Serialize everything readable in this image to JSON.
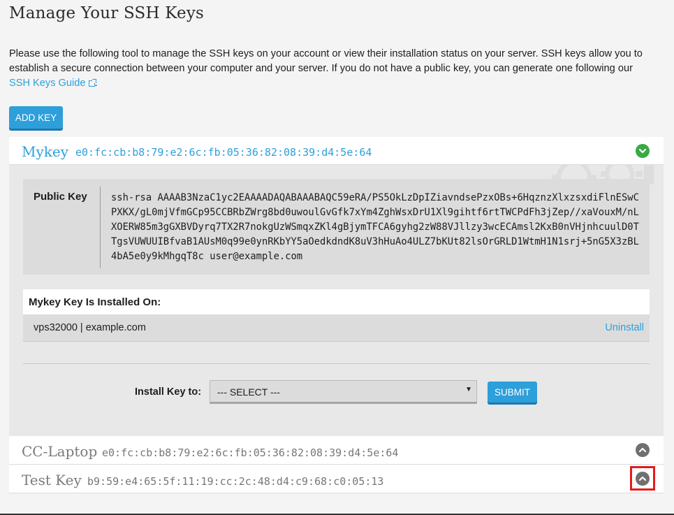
{
  "page": {
    "title": "Manage Your SSH Keys",
    "intro_text": "Please use the following tool to manage the SSH keys on your account or view their installation status on your server. SSH keys allow you to establish a secure connection between your computer and your server. If you do not have a public key, you can generate one following our ",
    "guide_link": "SSH Keys Guide",
    "intro_end": ".",
    "add_key_label": "ADD KEY"
  },
  "keys": [
    {
      "name": "Mykey",
      "fingerprint": "e0:fc:cb:b8:79:e2:6c:fb:05:36:82:08:39:d4:5e:64",
      "expanded": true,
      "toggle_icon": "chevron-down-icon",
      "toggle_color": "#3aa844"
    },
    {
      "name": "CC-Laptop",
      "fingerprint": "e0:fc:cb:b8:79:e2:6c:fb:05:36:82:08:39:d4:5e:64",
      "expanded": false,
      "toggle_icon": "chevron-up-icon",
      "toggle_color": "#707070"
    },
    {
      "name": "Test Key",
      "fingerprint": "b9:59:e4:65:5f:11:19:cc:2c:48:d4:c9:68:c0:05:13",
      "expanded": false,
      "toggle_icon": "chevron-up-icon",
      "toggle_color": "#707070"
    }
  ],
  "details": {
    "public_key_label": "Public Key",
    "public_key": "ssh-rsa AAAAB3NzaC1yc2EAAAADAQABAAABAQC59eRA/PS5OkLzDpIZiavndsePzxOBs+6HqznzXlxzsxdiFlnESwCPXKX/gL0mjVfmGCp95CCBRbZWrg8bd0uwoulGvGfk7xYm4ZghWsxDrU1Xl9gihtf6rtTWCPdFh3jZep//xaVouxM/nLXOERW85m3gGXBVDyrq7TX2R7nokgUzWSmqxZKl4gBjymTFCA6gyhg2zW88VJllzy3wcECAmsl2KxB0nVHjnhcuulD0TTgsVUWUUIBfvaB1AUsM0q99e0ynRKbYY5aOedkdndK8uV3hHuAo4ULZ7bKUt82lsOrGRLD1WtmH1N1srj+5nG5X3zBL4bA5e0y9kMhgqT8c user@example.com",
    "installed_on_title": "Mykey Key Is Installed On:",
    "installed_host": "vps32000 | example.com",
    "uninstall_label": "Uninstall",
    "install_key_label": "Install Key to:",
    "select_value": "--- SELECT ---",
    "submit_label": "SUBMIT"
  },
  "colors": {
    "accent": "#2d9fdb",
    "success": "#3aa844",
    "highlight": "#e41b1b"
  }
}
